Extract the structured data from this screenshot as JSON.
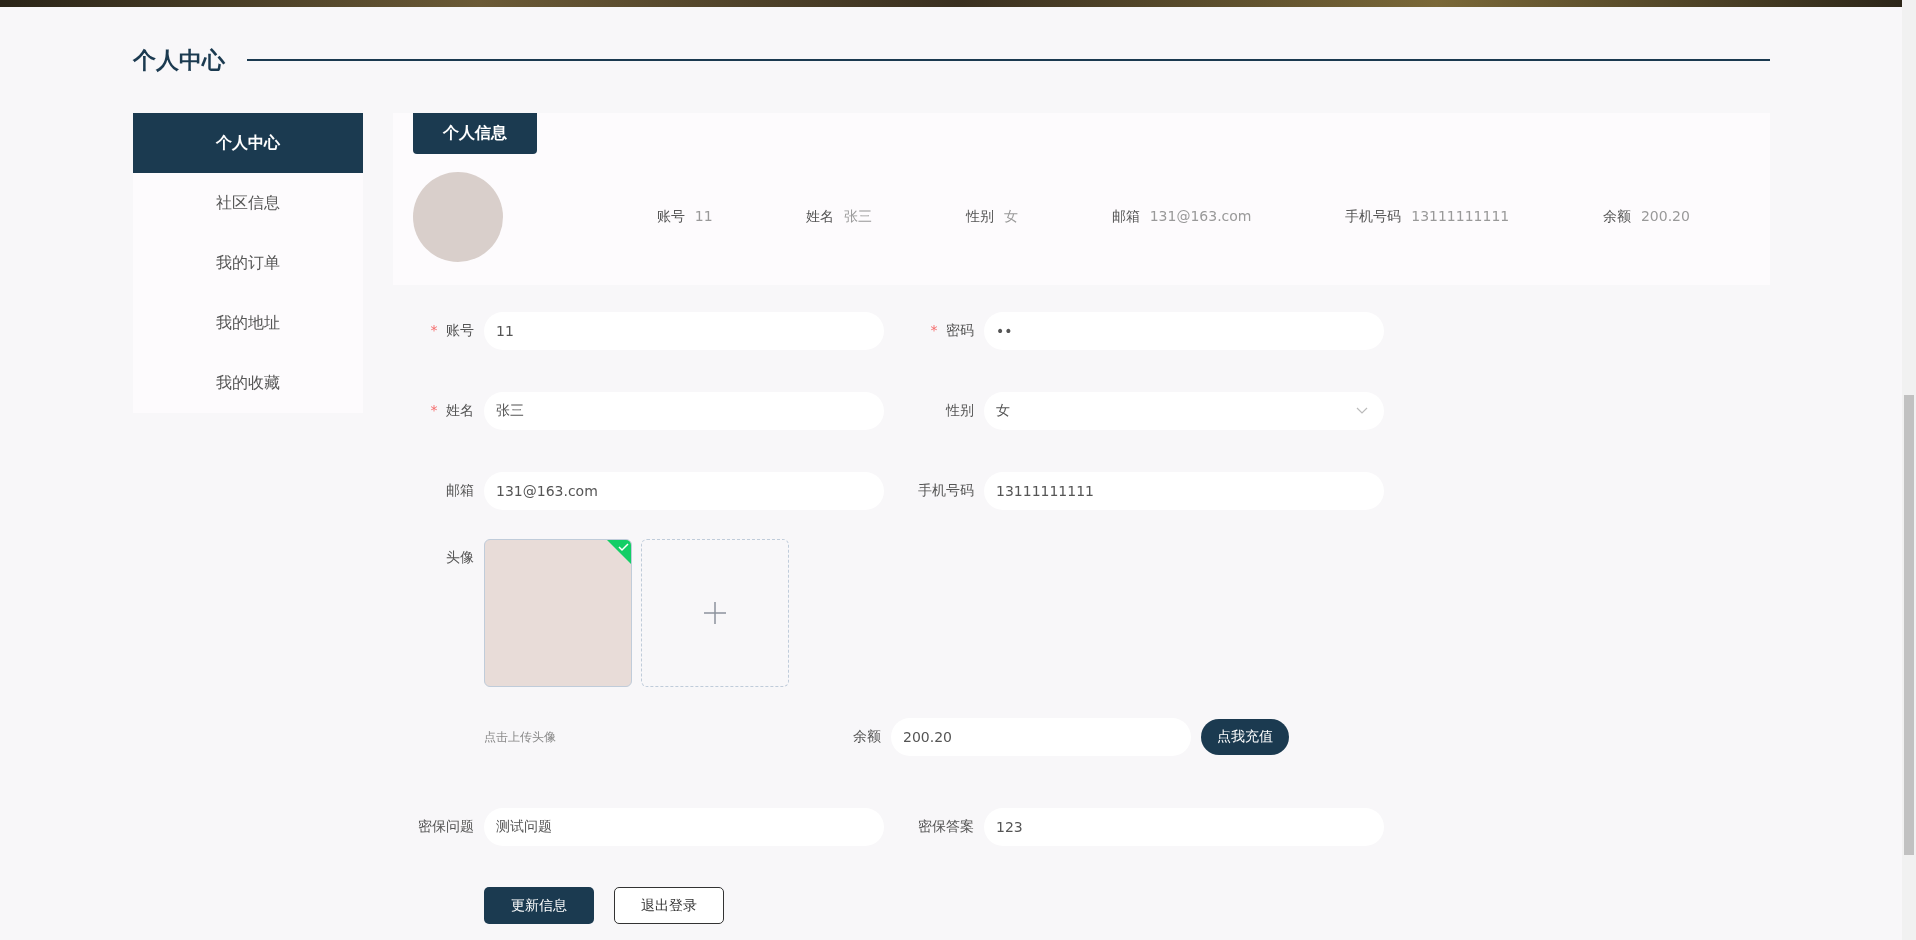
{
  "page_title": "个人中心",
  "sidebar": {
    "items": [
      {
        "label": "个人中心",
        "selected": true
      },
      {
        "label": "社区信息",
        "selected": false
      },
      {
        "label": "我的订单",
        "selected": false
      },
      {
        "label": "我的地址",
        "selected": false
      },
      {
        "label": "我的收藏",
        "selected": false
      }
    ]
  },
  "profile_tab": {
    "label": "个人信息"
  },
  "profile_summary": [
    {
      "label": "账号",
      "value": "11"
    },
    {
      "label": "姓名",
      "value": "张三"
    },
    {
      "label": "性别",
      "value": "女"
    },
    {
      "label": "邮箱",
      "value": "131@163.com"
    },
    {
      "label": "手机号码",
      "value": "13111111111"
    },
    {
      "label": "余额",
      "value": "200.20"
    }
  ],
  "form_rows": [
    [
      {
        "required_mark": "*",
        "label": "账号",
        "value": "11",
        "kind": "text"
      },
      {
        "required_mark": "*",
        "label": "密码",
        "value": "••",
        "kind": "text"
      }
    ],
    [
      {
        "required_mark": "*",
        "label": "姓名",
        "value": "张三",
        "kind": "text"
      },
      {
        "label": "性别",
        "value": "女",
        "kind": "select"
      }
    ],
    [
      {
        "label": "邮箱",
        "value": "131@163.com",
        "kind": "text"
      },
      {
        "label": "手机号码",
        "value": "13111111111",
        "kind": "text"
      }
    ]
  ],
  "avatar_upload": {
    "label": "头像",
    "uploaded": true,
    "hint": "点击上传头像"
  },
  "balance": {
    "label": "余额",
    "value": "200.20",
    "button": "点我充值"
  },
  "security_row": [
    {
      "label": "密保问题",
      "value": "测试问题",
      "kind": "text"
    },
    {
      "label": "密保答案",
      "value": "123",
      "kind": "text"
    }
  ],
  "buttons": [
    {
      "label": "更新信息",
      "kind": "primary"
    },
    {
      "label": "退出登录",
      "kind": "outline"
    }
  ]
}
